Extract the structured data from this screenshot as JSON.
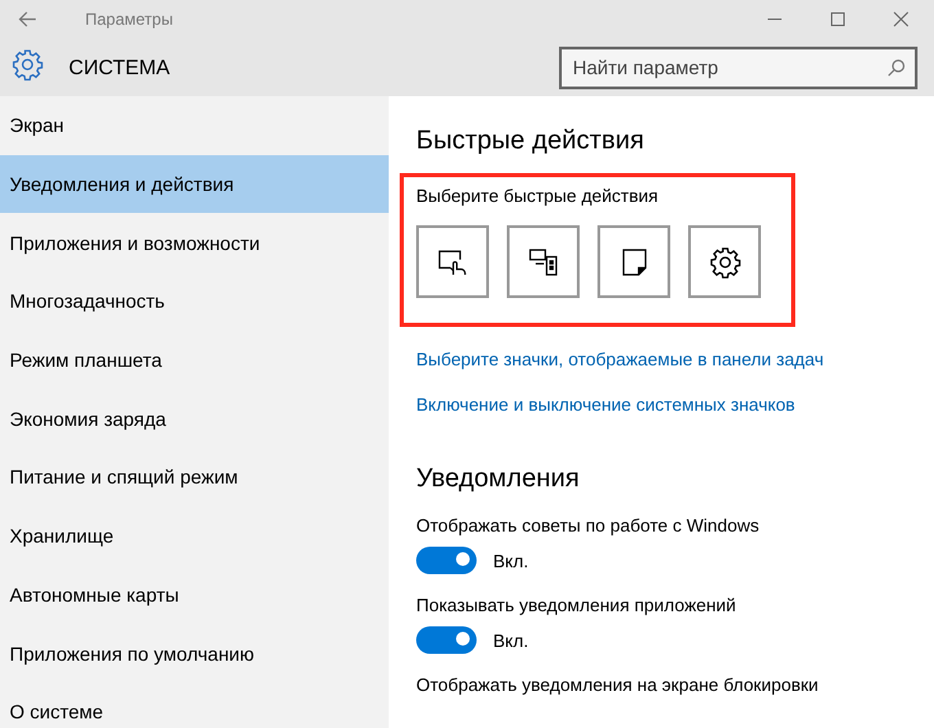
{
  "window": {
    "title": "Параметры",
    "controls": [
      {
        "kind": "minimize"
      },
      {
        "kind": "maximize"
      },
      {
        "kind": "close"
      }
    ]
  },
  "header": {
    "title": "СИСТЕМА",
    "search": {
      "placeholder": "Найти параметр"
    }
  },
  "sidebar": {
    "items": [
      {
        "label": "Экран",
        "selected": false
      },
      {
        "label": "Уведомления и действия",
        "selected": true
      },
      {
        "label": "Приложения и возможности",
        "selected": false
      },
      {
        "label": "Многозадачность",
        "selected": false
      },
      {
        "label": "Режим планшета",
        "selected": false
      },
      {
        "label": "Экономия заряда",
        "selected": false
      },
      {
        "label": "Питание и спящий режим",
        "selected": false
      },
      {
        "label": "Хранилище",
        "selected": false
      },
      {
        "label": "Автономные карты",
        "selected": false
      },
      {
        "label": "Приложения по умолчанию",
        "selected": false
      },
      {
        "label": "О системе",
        "selected": false
      }
    ]
  },
  "quick_actions": {
    "heading": "Быстрые действия",
    "label": "Выберите быстрые действия",
    "tiles": [
      {
        "kind": "tablet"
      },
      {
        "kind": "project"
      },
      {
        "kind": "note"
      },
      {
        "kind": "settings"
      }
    ],
    "links": [
      "Выберите значки, отображаемые в панели задач",
      "Включение и выключение системных значков"
    ]
  },
  "notifications": {
    "heading": "Уведомления",
    "settings": [
      {
        "label": "Отображать советы по работе с Windows",
        "on": true,
        "state": "Вкл."
      },
      {
        "label": "Показывать уведомления приложений",
        "on": true,
        "state": "Вкл."
      },
      {
        "label": "Отображать уведомления на экране блокировки"
      }
    ]
  }
}
